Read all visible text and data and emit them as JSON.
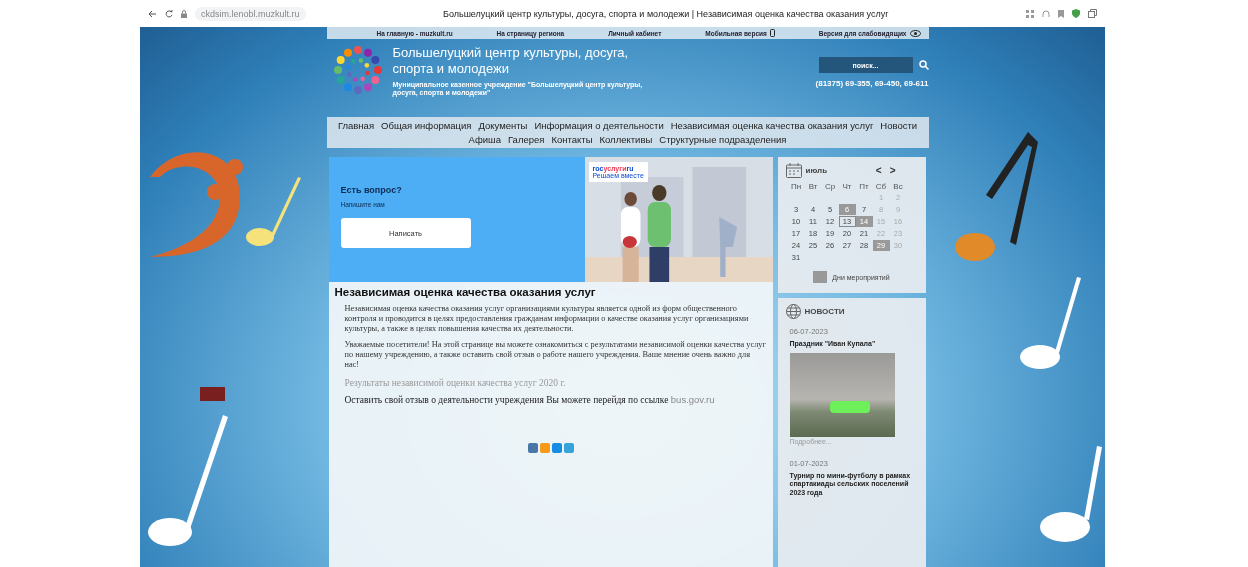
{
  "browser": {
    "url": "ckdsim.lenobl.muzkult.ru",
    "title": "Большелуцкий центр культуры, досуга, спорта и молодежи | Независимая оценка качества оказания услуг"
  },
  "top_links": [
    {
      "label": "На главную - muzkult.ru",
      "kind": "plain"
    },
    {
      "label": "На страницу региона",
      "kind": "plain"
    },
    {
      "label": "Личный кабинет",
      "kind": "plain"
    },
    {
      "label": "Мобильная версия",
      "kind": "phone"
    },
    {
      "label": "Версия для слабовидящих",
      "kind": "eye"
    }
  ],
  "header": {
    "title": "Большелуцкий центр культуры, досуга, спорта и молодежи",
    "subtitle": "Муниципальное казенное учреждение \"Большелуцкий центр культуры, досуга, спорта и молодежи\"",
    "search": {
      "placeholder": "поиск..."
    },
    "phone": "(81375) 69-355, 69-450, 69-611"
  },
  "nav": [
    [
      {
        "label": "Главная"
      },
      {
        "label": "Общая информация"
      },
      {
        "label": "Документы"
      },
      {
        "label": "Информация о деятельности"
      },
      {
        "label": "Независимая оценка качества оказания услуг"
      },
      {
        "label": "Новости"
      }
    ],
    [
      {
        "label": "Афиша"
      },
      {
        "label": "Галерея"
      },
      {
        "label": "Контакты"
      },
      {
        "label": "Коллективы"
      },
      {
        "label": "Структурные подразделения"
      }
    ]
  ],
  "banner": {
    "title": "Есть вопрос?",
    "subtitle": "Напишите нам",
    "button": "Написать",
    "brand_a": "гос",
    "brand_b": "услуги",
    "brand_c": "ru",
    "slogan": "Решаем вместе"
  },
  "article": {
    "title": "Независимая оценка качества оказания услуг",
    "paragraphs": [
      "Независимая оценка качества оказания услуг организациями культуры является одной из форм общественного контроля и проводится в целях предоставления гражданам информации о качестве оказания услуг организациями культуры, а также в целях повышения качества их деятельности.",
      "Уважаемые посетители! На этой странице вы можете ознакомиться с результатами независимой оценки качества услуг по нашему учреждению, а также оставить свой отзыв о работе нашего учреждения. Ваше мнение очень важно для нас!"
    ],
    "results_link": "Результаты независимой оценки качества услуг 2020 г.",
    "feedback": {
      "text": "Оставить свой отзыв о деятельности учреждения Вы можете перейдя по ссылке",
      "link": "bus.gov.ru"
    }
  },
  "calendar": {
    "month": "июль",
    "prev": "<",
    "next": ">",
    "weekdays": [
      "Пн",
      "Вт",
      "Ср",
      "Чт",
      "Пт",
      "Сб",
      "Вс"
    ],
    "weeks": [
      {
        "leading_blank": true,
        "days": [
          {
            "day": "1",
            "event": false,
            "today": false
          },
          {
            "day": "2",
            "event": false,
            "today": false
          }
        ]
      },
      {
        "days": [
          {
            "day": "3",
            "event": false,
            "today": false
          },
          {
            "day": "4",
            "event": false,
            "today": false
          },
          {
            "day": "5",
            "event": false,
            "today": false
          },
          {
            "day": "6",
            "event": true,
            "today": false
          },
          {
            "day": "7",
            "event": false,
            "today": false
          },
          {
            "day": "8",
            "event": false,
            "today": false
          },
          {
            "day": "9",
            "event": false,
            "today": false
          }
        ]
      },
      {
        "days": [
          {
            "day": "10",
            "event": false,
            "today": false
          },
          {
            "day": "11",
            "event": false,
            "today": false
          },
          {
            "day": "12",
            "event": false,
            "today": false
          },
          {
            "day": "13",
            "event": false,
            "today": true
          },
          {
            "day": "14",
            "event": true,
            "today": false
          },
          {
            "day": "15",
            "event": false,
            "today": false
          },
          {
            "day": "16",
            "event": false,
            "today": false
          }
        ]
      },
      {
        "days": [
          {
            "day": "17",
            "event": false,
            "today": false
          },
          {
            "day": "18",
            "event": false,
            "today": false
          },
          {
            "day": "19",
            "event": false,
            "today": false
          },
          {
            "day": "20",
            "event": false,
            "today": false
          },
          {
            "day": "21",
            "event": false,
            "today": false
          },
          {
            "day": "22",
            "event": false,
            "today": false
          },
          {
            "day": "23",
            "event": false,
            "today": false
          }
        ]
      },
      {
        "days": [
          {
            "day": "24",
            "event": false,
            "today": false
          },
          {
            "day": "25",
            "event": false,
            "today": false
          },
          {
            "day": "26",
            "event": false,
            "today": false
          },
          {
            "day": "27",
            "event": false,
            "today": false
          },
          {
            "day": "28",
            "event": false,
            "today": false
          },
          {
            "day": "29",
            "event": true,
            "today": false
          },
          {
            "day": "30",
            "event": false,
            "today": false
          }
        ]
      },
      {
        "leading_blank": false,
        "days": [
          {
            "day": "31",
            "event": false,
            "today": false
          }
        ]
      }
    ],
    "legend": "Дни мероприятий"
  },
  "news": {
    "title": "НОВОСТИ",
    "items": [
      {
        "date": "06-07-2023",
        "title": "Праздник \"Иван Купала\"",
        "photo": true,
        "more": "Подробнее..."
      },
      {
        "date": "01-07-2023",
        "title": "Турнир по мини-футболу в рамках спартакиады сельских поселений 2023 года"
      }
    ]
  }
}
